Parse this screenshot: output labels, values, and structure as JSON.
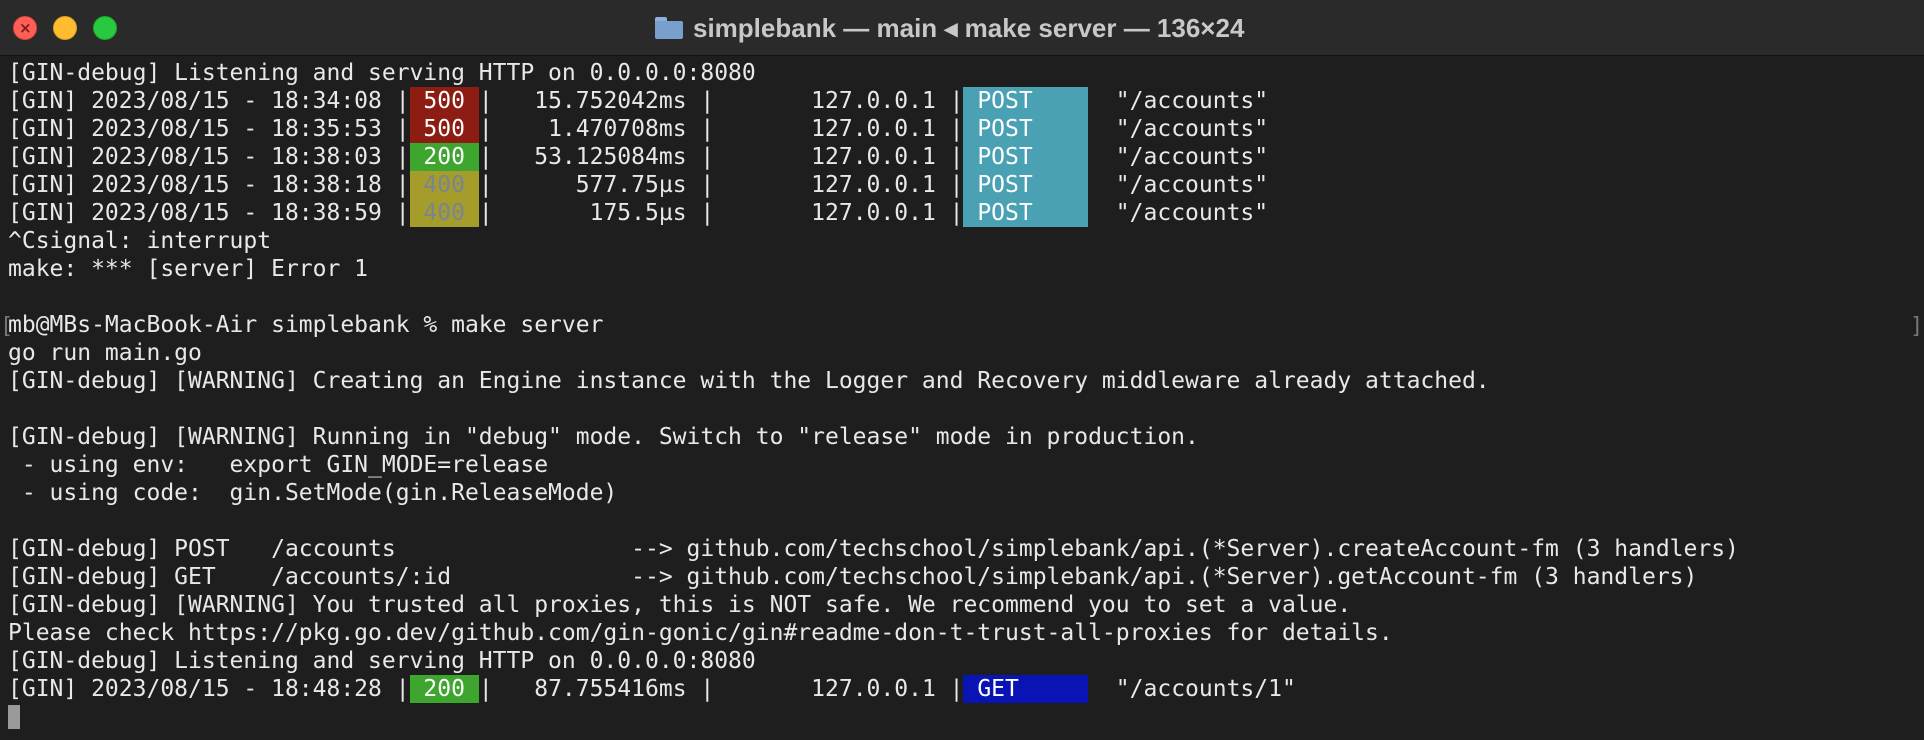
{
  "window": {
    "title": "simplebank — main ◂ make server — 136×24",
    "folder_icon": "folder-icon",
    "colors": {
      "background": "#1e1e1e",
      "titlebar": "#2a2a2a",
      "status_500": "#8d1d12",
      "status_200": "#3ea52e",
      "status_400": "#a49d2c",
      "method_post": "#4aa1b3",
      "method_get": "#0a14b4"
    }
  },
  "terminal": {
    "listening_1": "[GIN-debug] Listening and serving HTTP on 0.0.0.0:8080",
    "requests": [
      {
        "prefix": "[GIN] 2023/08/15 - 18:34:08 |",
        "status": " 500 ",
        "middle": "|   15.752042ms |       127.0.0.1 |",
        "method": " POST    ",
        "path": "  \"/accounts\""
      },
      {
        "prefix": "[GIN] 2023/08/15 - 18:35:53 |",
        "status": " 500 ",
        "middle": "|    1.470708ms |       127.0.0.1 |",
        "method": " POST    ",
        "path": "  \"/accounts\""
      },
      {
        "prefix": "[GIN] 2023/08/15 - 18:38:03 |",
        "status": " 200 ",
        "middle": "|   53.125084ms |       127.0.0.1 |",
        "method": " POST    ",
        "path": "  \"/accounts\""
      },
      {
        "prefix": "[GIN] 2023/08/15 - 18:38:18 |",
        "status": " 400 ",
        "middle": "|      577.75µs |       127.0.0.1 |",
        "method": " POST    ",
        "path": "  \"/accounts\""
      },
      {
        "prefix": "[GIN] 2023/08/15 - 18:38:59 |",
        "status": " 400 ",
        "middle": "|       175.5µs |       127.0.0.1 |",
        "method": " POST    ",
        "path": "  \"/accounts\""
      }
    ],
    "interrupt": "^Csignal: interrupt",
    "make_error": "make: *** [server] Error 1",
    "blank_1": "",
    "prompt": "mb@MBs-MacBook-Air simplebank % make server",
    "go_run": "go run main.go",
    "warning_engine": "[GIN-debug] [WARNING] Creating an Engine instance with the Logger and Recovery middleware already attached.",
    "blank_2": "",
    "warning_debug": "[GIN-debug] [WARNING] Running in \"debug\" mode. Switch to \"release\" mode in production.",
    "using_env": " - using env:   export GIN_MODE=release",
    "using_code": " - using code:  gin.SetMode(gin.ReleaseMode)",
    "blank_3": "",
    "route_post": "[GIN-debug] POST   /accounts                 --> github.com/techschool/simplebank/api.(*Server).createAccount-fm (3 handlers)",
    "route_get": "[GIN-debug] GET    /accounts/:id             --> github.com/techschool/simplebank/api.(*Server).getAccount-fm (3 handlers)",
    "warning_proxies": "[GIN-debug] [WARNING] You trusted all proxies, this is NOT safe. We recommend you to set a value.",
    "please_check": "Please check https://pkg.go.dev/github.com/gin-gonic/gin#readme-don-t-trust-all-proxies for details.",
    "listening_2": "[GIN-debug] Listening and serving HTTP on 0.0.0.0:8080",
    "last_request": {
      "prefix": "[GIN] 2023/08/15 - 18:48:28 |",
      "status": " 200 ",
      "middle": "|   87.755416ms |       127.0.0.1 |",
      "method": " GET     ",
      "path": "  \"/accounts/1\""
    }
  }
}
